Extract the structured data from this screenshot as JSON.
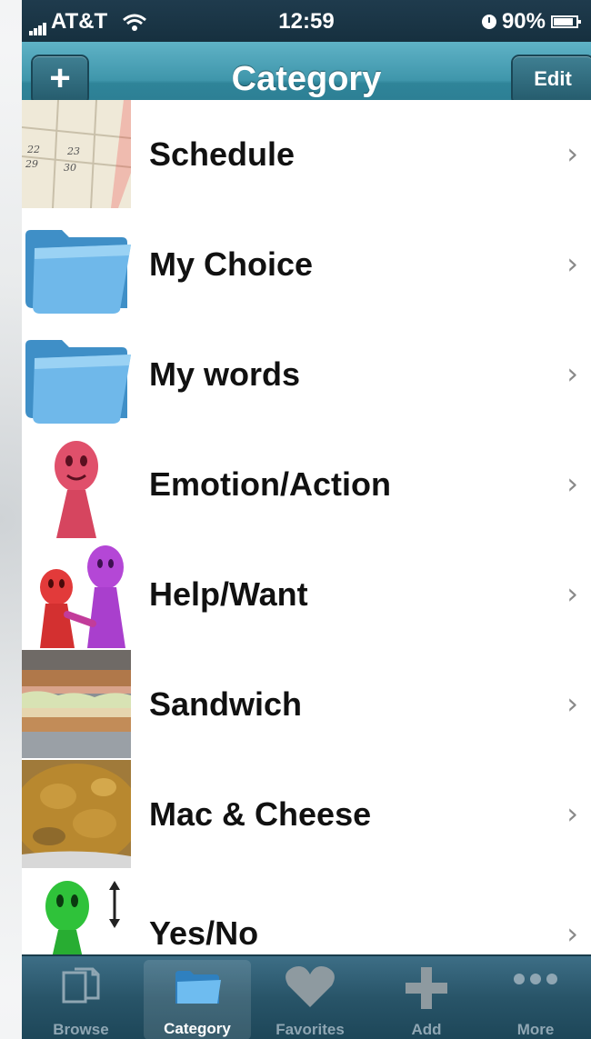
{
  "status_bar": {
    "carrier": "AT&T",
    "time": "12:59",
    "battery": "90%"
  },
  "nav": {
    "title": "Category",
    "add_label": "+",
    "edit_label": "Edit"
  },
  "categories": [
    {
      "label": "Schedule",
      "icon": "calendar-icon"
    },
    {
      "label": "My Choice",
      "icon": "folder-icon"
    },
    {
      "label": "My words",
      "icon": "folder-icon"
    },
    {
      "label": "Emotion/Action",
      "icon": "pink-person-icon"
    },
    {
      "label": "Help/Want",
      "icon": "two-people-icon"
    },
    {
      "label": "Sandwich",
      "icon": "sandwich-photo"
    },
    {
      "label": "Mac & Cheese",
      "icon": "mac-and-cheese-photo"
    },
    {
      "label": "Yes/No",
      "icon": "green-person-arrow-icon"
    }
  ],
  "chevron": "›",
  "calendar_numbers": [
    "22",
    "23",
    "29",
    "30"
  ],
  "tabs": [
    {
      "label": "Browse",
      "icon": "browse-icon",
      "selected": false
    },
    {
      "label": "Category",
      "icon": "folder-icon",
      "selected": true
    },
    {
      "label": "Favorites",
      "icon": "heart-icon",
      "selected": false
    },
    {
      "label": "Add",
      "icon": "plus-icon",
      "selected": false
    },
    {
      "label": "More",
      "icon": "more-dots-icon",
      "selected": false
    }
  ],
  "colors": {
    "nav_bar": "#3f96ab",
    "tab_bar": "#285468",
    "folder_blue": "#5aa9dc"
  }
}
